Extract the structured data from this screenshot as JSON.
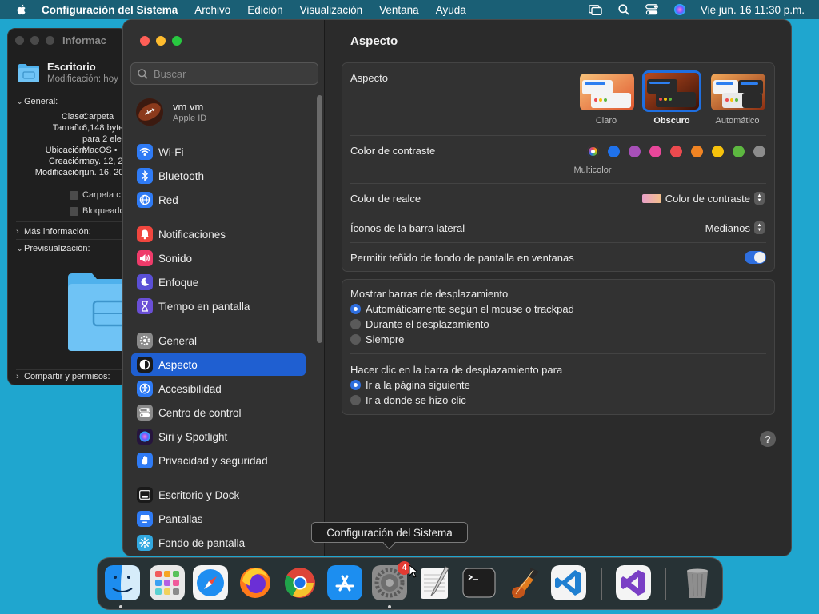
{
  "menubar": {
    "app_name": "Configuración del Sistema",
    "items": [
      "Archivo",
      "Edición",
      "Visualización",
      "Ventana",
      "Ayuda"
    ],
    "clock": "Vie jun. 16  11:30 p.m.",
    "status_icons": [
      "screen-mirroring-icon",
      "search-icon",
      "control-center-icon",
      "siri-icon"
    ]
  },
  "info_window": {
    "title": "Informac",
    "folder_name": "Escritorio",
    "modified_line": "Modificación: hoy",
    "general_label": "General:",
    "rows": [
      {
        "k": "Clase:",
        "v": "Carpeta"
      },
      {
        "k": "Tamaño:",
        "v": "6,148 byte"
      },
      {
        "k": "",
        "v": "para 2 ele"
      },
      {
        "k": "Ubicación:",
        "v": "MacOS •"
      },
      {
        "k": "Creación:",
        "v": "may. 12, 2"
      },
      {
        "k": "Modificación:",
        "v": "jun. 16, 20"
      }
    ],
    "checkbox_1": "Carpeta c",
    "checkbox_2": "Bloqueado",
    "more_info": "Más información:",
    "preview": "Previsualización:",
    "share": "Compartir y permisos:"
  },
  "settings": {
    "search_placeholder": "Buscar",
    "user": {
      "name": "vm vm",
      "sub": "Apple ID"
    },
    "sidebar": [
      {
        "label": "Wi-Fi",
        "icon": "wifi-icon",
        "color": "#2f7bf5"
      },
      {
        "label": "Bluetooth",
        "icon": "bluetooth-icon",
        "color": "#2f7bf5"
      },
      {
        "label": "Red",
        "icon": "network-icon",
        "color": "#2f7bf5"
      },
      {
        "label": "Notificaciones",
        "icon": "notifications-icon",
        "color": "#f0463e"
      },
      {
        "label": "Sonido",
        "icon": "sound-icon",
        "color": "#ef3b6a"
      },
      {
        "label": "Enfoque",
        "icon": "focus-icon",
        "color": "#5a4fd6"
      },
      {
        "label": "Tiempo en pantalla",
        "icon": "screen-time-icon",
        "color": "#6a4fd6"
      },
      {
        "label": "General",
        "icon": "general-icon",
        "color": "#8a8a8a"
      },
      {
        "label": "Aspecto",
        "icon": "appearance-icon",
        "color": "#1a1a1a"
      },
      {
        "label": "Accesibilidad",
        "icon": "accessibility-icon",
        "color": "#2f7bf5"
      },
      {
        "label": "Centro de control",
        "icon": "control-center-icon",
        "color": "#8a8a8a"
      },
      {
        "label": "Siri y Spotlight",
        "icon": "siri-icon",
        "color": "#b34fd6"
      },
      {
        "label": "Privacidad y seguridad",
        "icon": "privacy-icon",
        "color": "#2f7bf5"
      },
      {
        "label": "Escritorio y Dock",
        "icon": "desktop-dock-icon",
        "color": "#1a1a1a"
      },
      {
        "label": "Pantallas",
        "icon": "displays-icon",
        "color": "#2f7bf5"
      },
      {
        "label": "Fondo de pantalla",
        "icon": "wallpaper-icon",
        "color": "#32a8e0"
      }
    ],
    "active_item": "Aspecto",
    "main": {
      "title": "Aspecto",
      "appearance_label": "Aspecto",
      "themes": [
        "Claro",
        "Obscuro",
        "Automático"
      ],
      "selected_theme": "Obscuro",
      "contrast_label": "Color de contraste",
      "contrast_colors": [
        "multicolor",
        "#1f72ec",
        "#a750b8",
        "#e8479a",
        "#ec4a4f",
        "#f08423",
        "#f6c20c",
        "#5db740",
        "#8c8c8c"
      ],
      "multicolor_caption": "Multicolor",
      "highlight_label": "Color de realce",
      "highlight_value": "Color de contraste",
      "sidebar_icons_label": "Íconos de la barra lateral",
      "sidebar_icons_value": "Medianos",
      "tinting_label": "Permitir teñido de fondo de pantalla en ventanas",
      "tinting_on": true,
      "scrollbars_label": "Mostrar barras de desplazamiento",
      "scrollbars_options": [
        "Automáticamente según el mouse o trackpad",
        "Durante el desplazamiento",
        "Siempre"
      ],
      "scrollbars_selected": 0,
      "click_label": "Hacer clic en la barra de desplazamiento para",
      "click_options": [
        "Ir a la página siguiente",
        "Ir a donde se hizo clic"
      ],
      "click_selected": 0,
      "help": "?"
    }
  },
  "tooltip": "Configuración del Sistema",
  "dock": {
    "apps": [
      "finder-icon",
      "launchpad-icon",
      "safari-icon",
      "firefox-icon",
      "chrome-icon",
      "app-store-icon",
      "system-settings-icon",
      "textedit-icon",
      "terminal-icon",
      "garageband-icon",
      "vscode-icon",
      "visual-studio-icon",
      "trash-icon"
    ],
    "badge": "4"
  }
}
